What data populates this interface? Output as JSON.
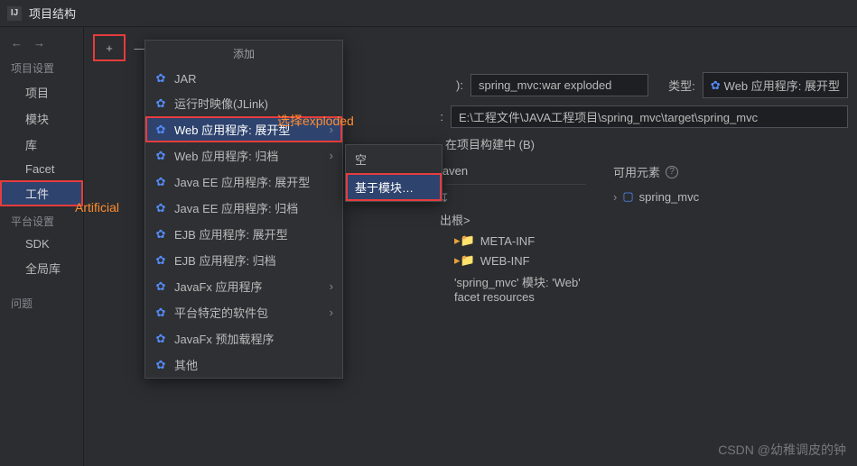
{
  "title_bar": {
    "logo": "IJ",
    "title": "项目结构"
  },
  "sidebar": {
    "section1_label": "项目设置",
    "items1": [
      "项目",
      "模块",
      "库",
      "Facet",
      "工件"
    ],
    "selected1_index": 4,
    "section2_label": "平台设置",
    "items2": [
      "SDK",
      "全局库"
    ],
    "section3_label": "问题"
  },
  "toolbar": {
    "plus": "+",
    "minus": "—",
    "copy": "⿻"
  },
  "fields": {
    "name_suffix_label": "):",
    "name_value": "spring_mvc:war exploded",
    "type_label": "类型:",
    "type_value": "Web 应用程序: 展开型",
    "outdir_suffix_label": ":",
    "outdir_value": "E:\\工程文件\\JAVA工程项目\\spring_mvc\\target\\spring_mvc",
    "include_build_label": "在项目构建中 (B)"
  },
  "lower": {
    "maven_label": "laven",
    "output_root": "出根>",
    "meta_inf": "META-INF",
    "web_inf": "WEB-INF",
    "facet_line": "'spring_mvc' 模块: 'Web' facet resources",
    "toolbar_icon": "↧"
  },
  "avail": {
    "header": "可用元素",
    "item": "spring_mvc"
  },
  "dropdown": {
    "title": "添加",
    "items": [
      {
        "label": "JAR",
        "chev": false
      },
      {
        "label": "运行时映像(JLink)",
        "chev": false
      },
      {
        "label": "Web 应用程序: 展开型",
        "chev": true,
        "selected": true
      },
      {
        "label": "Web 应用程序: 归档",
        "chev": true
      },
      {
        "label": "Java EE 应用程序: 展开型",
        "chev": false
      },
      {
        "label": "Java EE 应用程序: 归档",
        "chev": false
      },
      {
        "label": "EJB 应用程序: 展开型",
        "chev": false
      },
      {
        "label": "EJB 应用程序: 归档",
        "chev": false
      },
      {
        "label": "JavaFx 应用程序",
        "chev": true
      },
      {
        "label": "平台特定的软件包",
        "chev": true
      },
      {
        "label": "JavaFx 预加载程序",
        "chev": false
      },
      {
        "label": "其他",
        "chev": false
      }
    ]
  },
  "submenu": {
    "items": [
      {
        "label": "空",
        "selected": false
      },
      {
        "label": "基于模块…",
        "selected": true
      }
    ]
  },
  "annotations": {
    "a1": "选择exploded",
    "a2": "Artificial"
  },
  "watermark": "CSDN @幼稚调皮的钟"
}
